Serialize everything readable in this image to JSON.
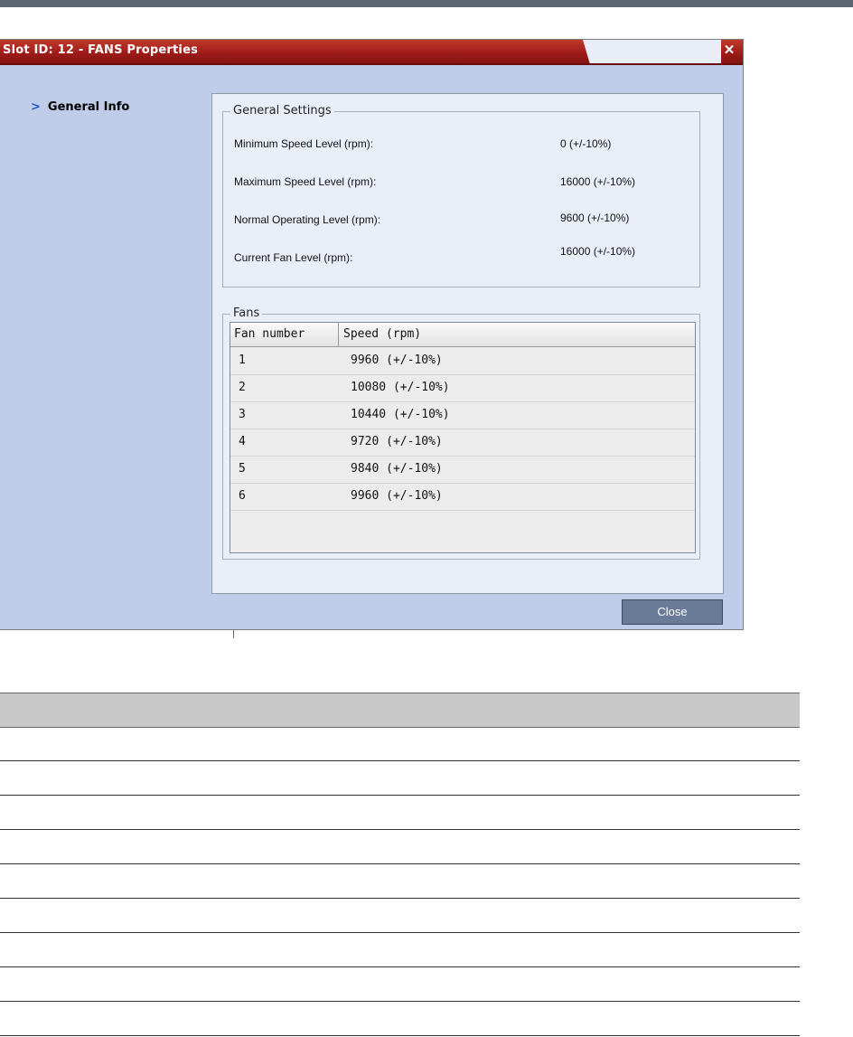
{
  "dialog": {
    "title": "Slot ID: 12 - FANS Properties",
    "close_glyph": "✕",
    "nav": {
      "chevron": ">",
      "label": "General Info"
    },
    "general_settings": {
      "title": "General Settings",
      "rows": [
        {
          "label": "Minimum Speed Level (rpm):",
          "value": "0  (+/-10%)"
        },
        {
          "label": "Maximum Speed Level (rpm):",
          "value": "16000  (+/-10%)"
        },
        {
          "label": "Normal Operating Level (rpm):",
          "value": "9600  (+/-10%)"
        },
        {
          "label": "Current Fan Level (rpm):",
          "value": "16000  (+/-10%)"
        }
      ]
    },
    "fans": {
      "title": "Fans",
      "columns": [
        "Fan number",
        "Speed (rpm)"
      ],
      "rows": [
        {
          "fan": "1",
          "speed": "9960  (+/-10%)"
        },
        {
          "fan": "2",
          "speed": "10080  (+/-10%)"
        },
        {
          "fan": "3",
          "speed": "10440  (+/-10%)"
        },
        {
          "fan": "4",
          "speed": "9720  (+/-10%)"
        },
        {
          "fan": "5",
          "speed": "9840  (+/-10%)"
        },
        {
          "fan": "6",
          "speed": "9960  (+/-10%)"
        }
      ]
    },
    "close_button": "Close"
  },
  "colors": {
    "titlebar": "#9c1a17",
    "dialog_bg": "#bfcde9",
    "panel_bg": "#e9eef9",
    "button": "#6a7b97",
    "accent": "#1e5bc6"
  }
}
